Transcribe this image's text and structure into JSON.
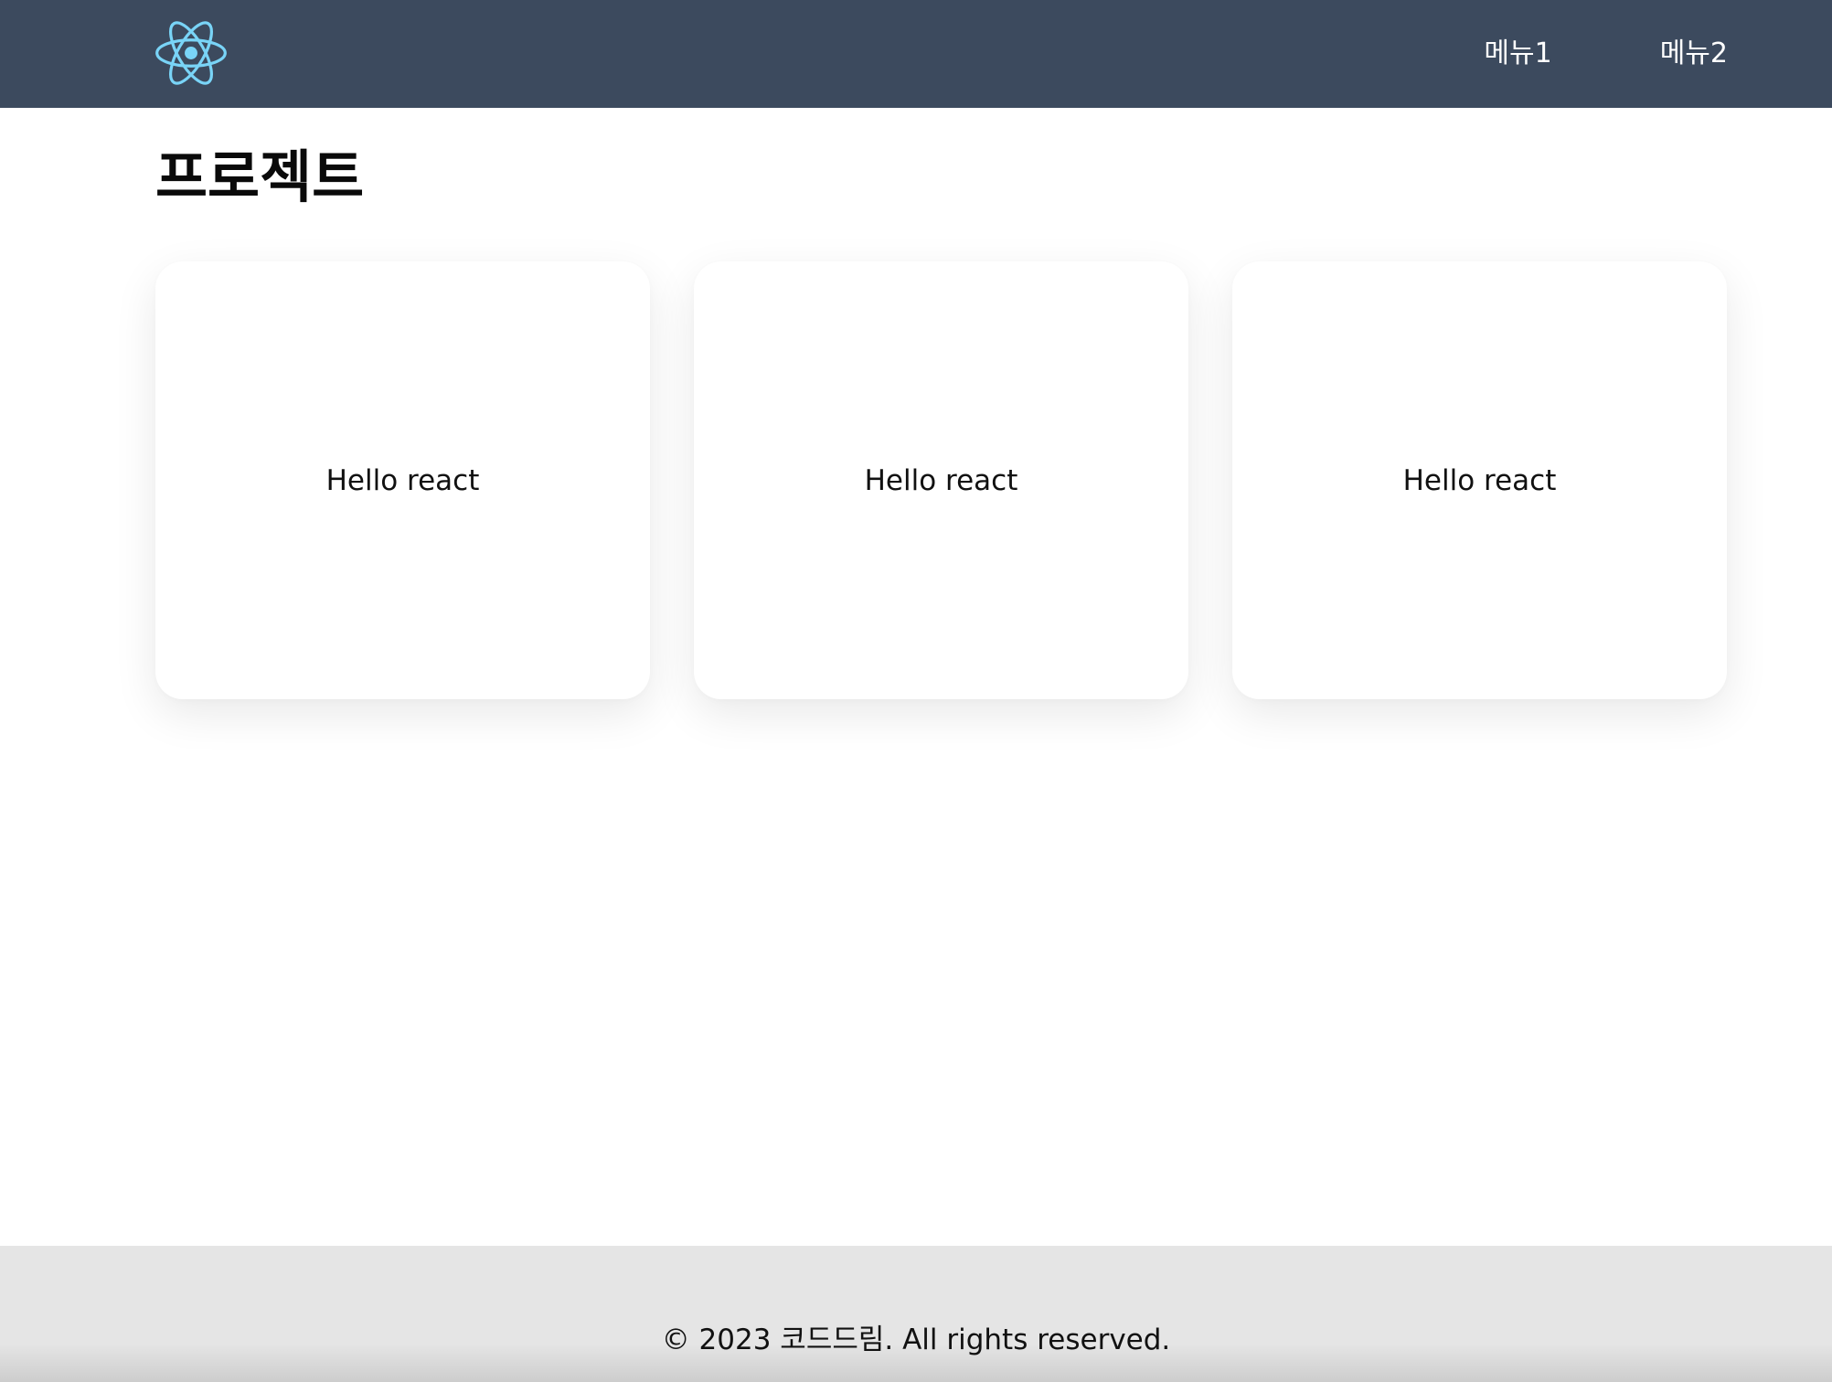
{
  "header": {
    "logo_icon": "react-atom-icon",
    "nav": [
      {
        "label": "메뉴1"
      },
      {
        "label": "메뉴2"
      }
    ]
  },
  "main": {
    "title": "프로젝트",
    "cards": [
      {
        "text": "Hello react"
      },
      {
        "text": "Hello react"
      },
      {
        "text": "Hello react"
      }
    ]
  },
  "footer": {
    "text": "© 2023 코드드림. All rights reserved."
  },
  "colors": {
    "header_bg": "#3c4a5e",
    "logo_accent": "#79d4f7",
    "footer_bg": "#e5e5e5"
  }
}
